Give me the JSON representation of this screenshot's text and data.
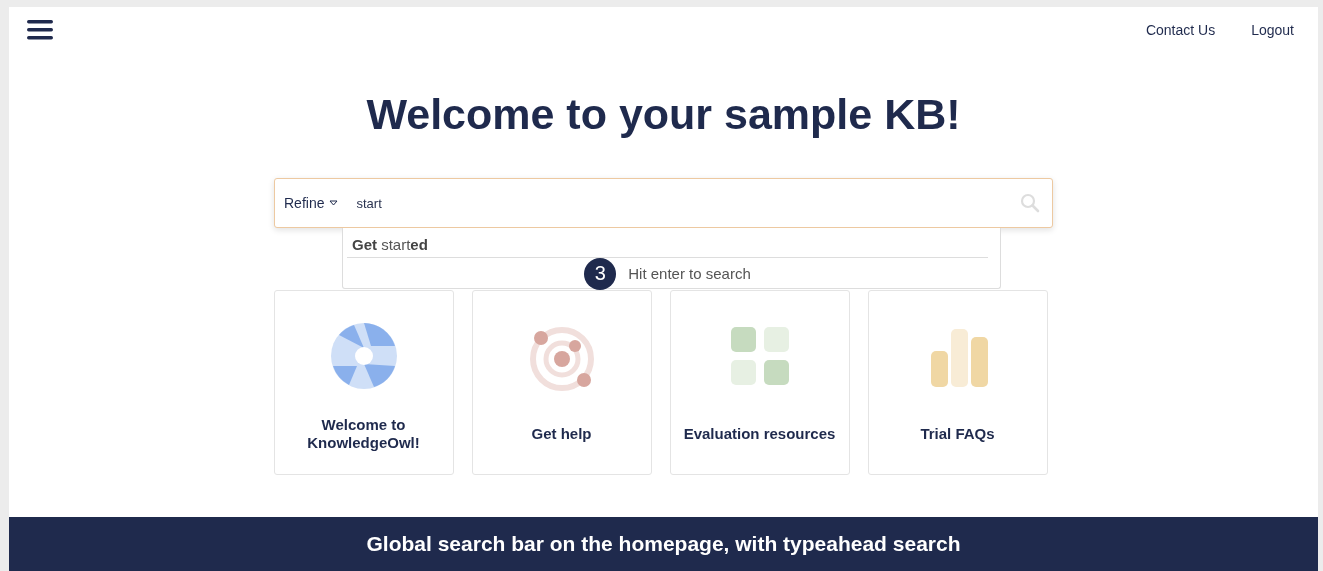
{
  "header": {
    "nav_links": [
      "Contact Us",
      "Logout"
    ]
  },
  "title": "Welcome to your sample KB!",
  "search": {
    "refine_label": "Refine",
    "value": "start",
    "suggestions": [
      "**Get** start**ed**"
    ],
    "hint": {
      "step": "3",
      "text": "Hit enter to search"
    }
  },
  "cards": [
    {
      "kind": "aperture",
      "label": "Welcome to KnowledgeOwl!"
    },
    {
      "kind": "orbit",
      "label": "Get help"
    },
    {
      "kind": "grid",
      "label": "Evaluation resources"
    },
    {
      "kind": "bars",
      "label": "Trial FAQs"
    }
  ],
  "caption": "Global search bar on the homepage, with typeahead search"
}
